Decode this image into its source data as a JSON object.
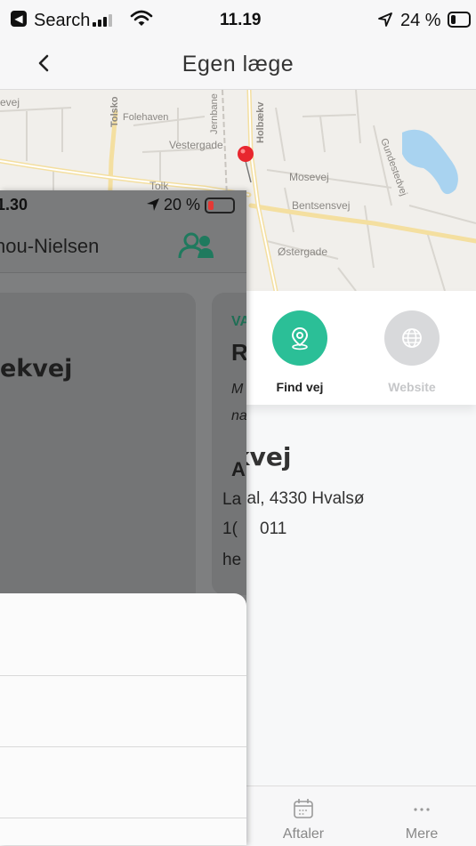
{
  "status_bar": {
    "back_app": "Search",
    "time": "11.19",
    "battery_percent": "24 %",
    "battery_level": 0.24
  },
  "nav": {
    "title": "Egen læge"
  },
  "map": {
    "streets": [
      "Tolsko",
      "Folehaven",
      "Vestergade",
      "Jernbane",
      "Holbækv",
      "Mosevej",
      "Bentsensvej",
      "Østergade",
      "Gundestedvej",
      "Tolk",
      "evej"
    ]
  },
  "actions": [
    {
      "label": "Find vej",
      "icon": "location-pin-icon",
      "color": "#2bbf97",
      "enabled": true
    },
    {
      "label": "Website",
      "icon": "globe-icon",
      "color": "#d8d9db",
      "enabled": false
    }
  ],
  "address": {
    "title_fragment": "kvej",
    "line1": "sal, 4330 Hvalsø",
    "line2": "011"
  },
  "tab_bar": [
    {
      "label": "Aftaler",
      "icon": "calendar-icon"
    },
    {
      "label": "Mere",
      "icon": "more-dots-icon"
    }
  ],
  "overlay": {
    "status_time": "1.30",
    "battery_percent": "20 %",
    "battery_level": 0.2,
    "title": "nou-Nielsen",
    "card_title": "ekvej",
    "card2_heading": "VA",
    "card2_letter": "R",
    "card2_italic1": "M",
    "card2_italic2": "na",
    "card2_bold": "Al",
    "card2_line1": "La",
    "card2_line2": "1(",
    "card2_line3": "he"
  },
  "colors": {
    "accent": "#2bbf97",
    "battery_low": "#e53935",
    "map_pin": "#e8262e"
  }
}
